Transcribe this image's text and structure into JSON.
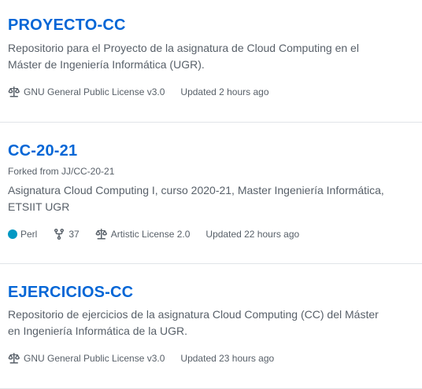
{
  "repos": [
    {
      "name": "PROYECTO-CC",
      "description": "Repositorio para el Proyecto de la asignatura de Cloud Computing en el Máster de Ingeniería Informática (UGR).",
      "license": "GNU General Public License v3.0",
      "updated": "Updated 2 hours ago",
      "icons": {
        "license": "law-icon"
      }
    },
    {
      "name": "CC-20-21",
      "forked_from": "Forked from JJ/CC-20-21",
      "description": "Asignatura Cloud Computing I, curso 2020-21, Master Ingeniería Informática, ETSIIT UGR",
      "language": "Perl",
      "language_color": "#0298c3",
      "forks": "37",
      "license": "Artistic License 2.0",
      "updated": "Updated 22 hours ago",
      "icons": {
        "forks": "repo-forked-icon",
        "license": "law-icon"
      }
    },
    {
      "name": "EJERCICIOS-CC",
      "description": "Repositorio de ejercicios de la asignatura Cloud Computing (CC) del Máster en Ingeniería Informática de la UGR.",
      "license": "GNU General Public License v3.0",
      "updated": "Updated 23 hours ago",
      "icons": {
        "license": "law-icon"
      }
    }
  ],
  "colors": {
    "link": "#0366d6",
    "muted": "#586069",
    "divider": "#e1e4e8"
  }
}
